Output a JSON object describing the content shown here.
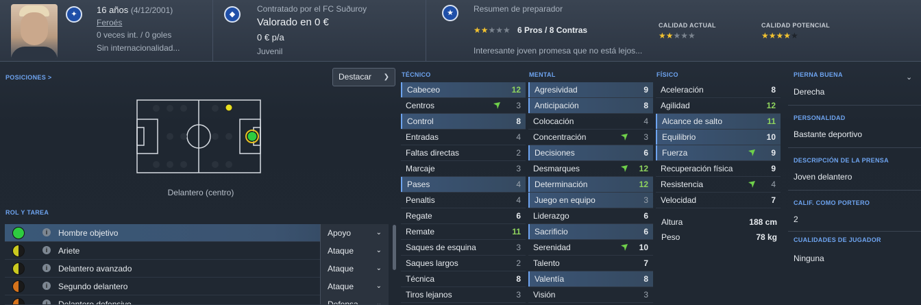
{
  "header": {
    "age": "16 años",
    "dob": "(4/12/2001)",
    "nation": "Feroés",
    "caps": "0 veces int. / 0 goles",
    "intl_status": "Sin internacionalidad...",
    "contract": "Contratado por el FC Suðuroy",
    "valuation": "Valorado en 0 €",
    "wage": "0 € p/a",
    "squad": "Juvenil",
    "scout_title": "Resumen de preparador",
    "pros_cons": "6 Pros / 8 Contras",
    "scout_summary": "Interesante joven promesa que no está lejos...",
    "current_ability_label": "CALIDAD ACTUAL",
    "potential_ability_label": "CALIDAD POTENCIAL",
    "scout_stars": 2,
    "current_stars": 2,
    "potential_stars": 4
  },
  "positions": {
    "title": "POSICIONES >",
    "dropdown": "Destacar",
    "caption": "Delantero (centro)"
  },
  "roles": {
    "title": "ROL Y TAREA",
    "items": [
      {
        "name": "Hombre objetivo",
        "duty": "Apoyo",
        "dot_color": "#2ecc40"
      },
      {
        "name": "Ariete",
        "duty": "Ataque",
        "dot_color": "#c9c920"
      },
      {
        "name": "Delantero avanzado",
        "duty": "Ataque",
        "dot_color": "#c9c920"
      },
      {
        "name": "Segundo delantero",
        "duty": "Ataque",
        "dot_color": "#d5731c"
      },
      {
        "name": "Delantero defensivo",
        "duty": "Defensa",
        "dot_color": "#d5731c"
      }
    ]
  },
  "attributes": {
    "technical_title": "TÉCNICO",
    "mental_title": "MENTAL",
    "physical_title": "FÍSICO",
    "technical": [
      {
        "name": "Cabeceo",
        "value": "12",
        "style": "green",
        "hl": true,
        "arrow": false
      },
      {
        "name": "Centros",
        "value": "3",
        "style": "grey",
        "hl": false,
        "arrow": true
      },
      {
        "name": "Control",
        "value": "8",
        "style": "normal",
        "hl": true,
        "arrow": false
      },
      {
        "name": "Entradas",
        "value": "4",
        "style": "grey",
        "hl": false,
        "arrow": false
      },
      {
        "name": "Faltas directas",
        "value": "2",
        "style": "grey",
        "hl": false,
        "arrow": false
      },
      {
        "name": "Marcaje",
        "value": "3",
        "style": "grey",
        "hl": false,
        "arrow": false
      },
      {
        "name": "Pases",
        "value": "4",
        "style": "grey",
        "hl": true,
        "arrow": false
      },
      {
        "name": "Penaltis",
        "value": "4",
        "style": "grey",
        "hl": false,
        "arrow": false
      },
      {
        "name": "Regate",
        "value": "6",
        "style": "normal",
        "hl": false,
        "arrow": false
      },
      {
        "name": "Remate",
        "value": "11",
        "style": "green",
        "hl": false,
        "arrow": false
      },
      {
        "name": "Saques de esquina",
        "value": "3",
        "style": "grey",
        "hl": false,
        "arrow": false
      },
      {
        "name": "Saques largos",
        "value": "2",
        "style": "grey",
        "hl": false,
        "arrow": false
      },
      {
        "name": "Técnica",
        "value": "8",
        "style": "normal",
        "hl": false,
        "arrow": false
      },
      {
        "name": "Tiros lejanos",
        "value": "3",
        "style": "grey",
        "hl": false,
        "arrow": false
      }
    ],
    "mental": [
      {
        "name": "Agresividad",
        "value": "9",
        "style": "normal",
        "hl": true,
        "arrow": false
      },
      {
        "name": "Anticipación",
        "value": "8",
        "style": "normal",
        "hl": true,
        "arrow": false
      },
      {
        "name": "Colocación",
        "value": "4",
        "style": "grey",
        "hl": false,
        "arrow": false
      },
      {
        "name": "Concentración",
        "value": "3",
        "style": "grey",
        "hl": false,
        "arrow": true
      },
      {
        "name": "Decisiones",
        "value": "6",
        "style": "normal",
        "hl": true,
        "arrow": false
      },
      {
        "name": "Desmarques",
        "value": "12",
        "style": "green",
        "hl": false,
        "arrow": true
      },
      {
        "name": "Determinación",
        "value": "12",
        "style": "green",
        "hl": true,
        "arrow": false
      },
      {
        "name": "Juego en equipo",
        "value": "3",
        "style": "grey",
        "hl": true,
        "arrow": false
      },
      {
        "name": "Liderazgo",
        "value": "6",
        "style": "normal",
        "hl": false,
        "arrow": false
      },
      {
        "name": "Sacrificio",
        "value": "6",
        "style": "normal",
        "hl": true,
        "arrow": false
      },
      {
        "name": "Serenidad",
        "value": "10",
        "style": "normal",
        "hl": false,
        "arrow": true
      },
      {
        "name": "Talento",
        "value": "7",
        "style": "normal",
        "hl": false,
        "arrow": false
      },
      {
        "name": "Valentía",
        "value": "8",
        "style": "normal",
        "hl": true,
        "arrow": false
      },
      {
        "name": "Visión",
        "value": "3",
        "style": "grey",
        "hl": false,
        "arrow": false
      }
    ],
    "physical": [
      {
        "name": "Aceleración",
        "value": "8",
        "style": "normal",
        "hl": false,
        "arrow": false
      },
      {
        "name": "Agilidad",
        "value": "12",
        "style": "green",
        "hl": false,
        "arrow": false
      },
      {
        "name": "Alcance de salto",
        "value": "11",
        "style": "green",
        "hl": true,
        "arrow": false
      },
      {
        "name": "Equilibrio",
        "value": "10",
        "style": "normal",
        "hl": true,
        "arrow": false
      },
      {
        "name": "Fuerza",
        "value": "9",
        "style": "normal",
        "hl": true,
        "arrow": true
      },
      {
        "name": "Recuperación física",
        "value": "9",
        "style": "normal",
        "hl": false,
        "arrow": false
      },
      {
        "name": "Resistencia",
        "value": "4",
        "style": "grey",
        "hl": false,
        "arrow": true
      },
      {
        "name": "Velocidad",
        "value": "7",
        "style": "normal",
        "hl": false,
        "arrow": false
      }
    ],
    "height_label": "Altura",
    "height_value": "188 cm",
    "weight_label": "Peso",
    "weight_value": "78 kg"
  },
  "info": {
    "foot_title": "PIERNA BUENA",
    "foot_value": "Derecha",
    "personality_title": "PERSONALIDAD",
    "personality_value": "Bastante deportivo",
    "press_title": "DESCRIPCIÓN DE LA PRENSA",
    "press_value": "Joven delantero",
    "gk_title": "CALIF. COMO PORTERO",
    "gk_value": "2",
    "traits_title": "CUALIDADES DE JUGADOR",
    "traits_value": "Ninguna"
  },
  "colors": {
    "accent": "#6ea4f0",
    "green_value": "#8fd45e",
    "star": "#f2c230"
  }
}
